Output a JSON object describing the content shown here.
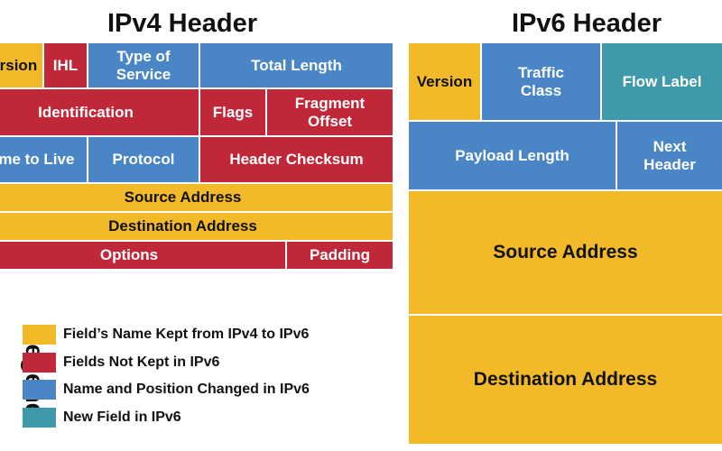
{
  "ipv4": {
    "title": "IPv4 Header",
    "fields": {
      "version": "Version",
      "ihl": "IHL",
      "tos_1": "Type of",
      "tos_2": "Service",
      "total_length": "Total Length",
      "identification": "Identification",
      "flags": "Flags",
      "frag_1": "Fragment",
      "frag_2": "Offset",
      "ttl": "Time to Live",
      "protocol": "Protocol",
      "checksum": "Header Checksum",
      "source": "Source Address",
      "destination": "Destination Address",
      "options": "Options",
      "padding": "Padding"
    }
  },
  "ipv6": {
    "title": "IPv6 Header",
    "fields": {
      "version": "Version",
      "tc_1": "Traffic",
      "tc_2": "Class",
      "flow_label": "Flow Label",
      "payload_length": "Payload Length",
      "nh_1": "Next",
      "nh_2": "Header",
      "source": "Source Address",
      "destination": "Destination Address"
    }
  },
  "legend": {
    "title": "Legend",
    "items": [
      {
        "label": "Field’s Name Kept from IPv4 to IPv6",
        "color": "#f2b929"
      },
      {
        "label": "Fields Not Kept in IPv6",
        "color": "#c0283a"
      },
      {
        "label": "Name and Position Changed in IPv6",
        "color": "#4a86c6"
      },
      {
        "label": "New Field in IPv6",
        "color": "#3e9aaa"
      }
    ]
  }
}
